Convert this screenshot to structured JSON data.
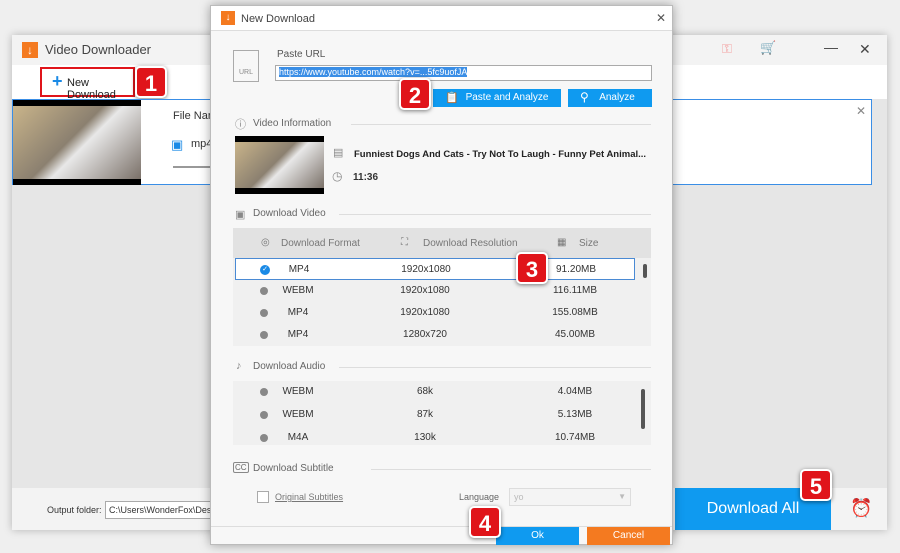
{
  "main": {
    "title": "Video Downloader",
    "new_download": "New Download",
    "file_name_label": "File Nam",
    "format": "mp4",
    "output_label": "Output folder:",
    "output_path": "C:\\Users\\WonderFox\\Desktop",
    "download_all": "Download All"
  },
  "badges": [
    "1",
    "2",
    "3",
    "4",
    "5"
  ],
  "dialog": {
    "title": "New Download",
    "paste_url_label": "Paste URL",
    "url": "https://www.youtube.com/watch?v=...5fc9uofJA",
    "paste_analyze": "Paste and Analyze",
    "analyze": "Analyze",
    "video_info": "Video Information",
    "video_title": "Funniest  Dogs And Cats - Try Not To Laugh - Funny Pet Animal...",
    "duration": "11:36",
    "download_video": "Download Video",
    "video_headers": [
      "Download Format",
      "Download Resolution",
      "Size"
    ],
    "video_rows": [
      {
        "format": "MP4",
        "res": "1920x1080",
        "size": "91.20MB",
        "selected": true
      },
      {
        "format": "WEBM",
        "res": "1920x1080",
        "size": "116.11MB",
        "selected": false
      },
      {
        "format": "MP4",
        "res": "1920x1080",
        "size": "155.08MB",
        "selected": false
      },
      {
        "format": "MP4",
        "res": "1280x720",
        "size": "45.00MB",
        "selected": false
      }
    ],
    "download_audio": "Download Audio",
    "audio_rows": [
      {
        "format": "WEBM",
        "bitrate": "68k",
        "size": "4.04MB"
      },
      {
        "format": "WEBM",
        "bitrate": "87k",
        "size": "5.13MB"
      },
      {
        "format": "M4A",
        "bitrate": "130k",
        "size": "10.74MB"
      }
    ],
    "download_subtitle": "Download Subtitle",
    "original_subtitles": "Original Subtitles",
    "language_label": "Language",
    "language_value": "yo",
    "ok": "Ok",
    "cancel": "Cancel"
  },
  "colors": {
    "accent": "#0f9af0",
    "badge": "#e0141a",
    "cancel": "#f47a20"
  }
}
